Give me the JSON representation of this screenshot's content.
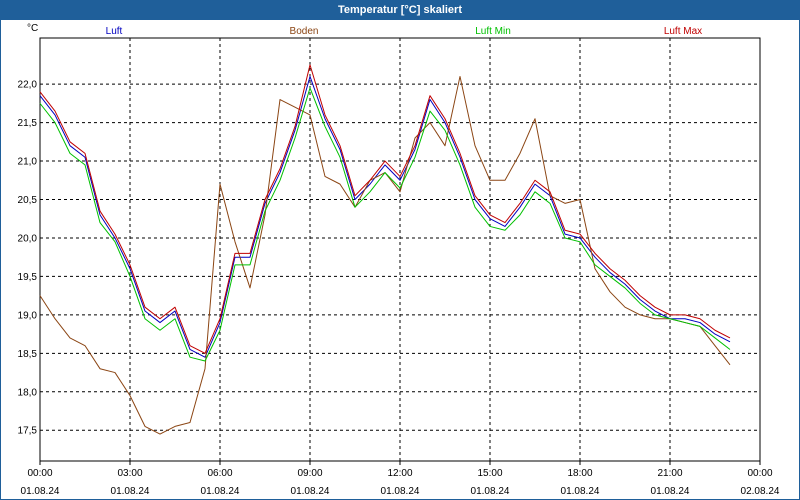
{
  "window": {
    "title": "Temperatur [°C] skaliert"
  },
  "chart_data": {
    "type": "line",
    "title": "Temperatur [°C] skaliert",
    "ylabel": "°C",
    "xlabel": "",
    "grid": true,
    "legend_position": "top",
    "ylim": [
      17.1,
      22.6
    ],
    "xlim": [
      0,
      24
    ],
    "yticks": [
      "17,5",
      "18,0",
      "18,5",
      "19,0",
      "19,5",
      "20,0",
      "20,5",
      "21,0",
      "21,5",
      "22,0"
    ],
    "xticks": [
      {
        "time": "00:00",
        "date": "01.08.24"
      },
      {
        "time": "03:00",
        "date": "01.08.24"
      },
      {
        "time": "06:00",
        "date": "01.08.24"
      },
      {
        "time": "09:00",
        "date": "01.08.24"
      },
      {
        "time": "12:00",
        "date": "01.08.24"
      },
      {
        "time": "15:00",
        "date": "01.08.24"
      },
      {
        "time": "18:00",
        "date": "01.08.24"
      },
      {
        "time": "21:00",
        "date": "01.08.24"
      },
      {
        "time": "00:00",
        "date": "02.08.24"
      }
    ],
    "x_hours": [
      0,
      0.5,
      1,
      1.5,
      2,
      2.5,
      3,
      3.5,
      4,
      4.5,
      5,
      5.5,
      6,
      6.5,
      7,
      7.5,
      8,
      8.5,
      9,
      9.5,
      10,
      10.5,
      11,
      11.5,
      12,
      12.5,
      13,
      13.5,
      14,
      14.5,
      15,
      15.5,
      16,
      16.5,
      17,
      17.5,
      18,
      18.5,
      19,
      19.5,
      20,
      20.5,
      21,
      21.5,
      22,
      22.5,
      23,
      23.5,
      24
    ],
    "series": [
      {
        "name": "Luft",
        "color": "#0000c0",
        "values": [
          21.85,
          21.6,
          21.2,
          21.05,
          20.3,
          20.0,
          19.6,
          19.05,
          18.9,
          19.05,
          18.55,
          18.45,
          18.9,
          19.75,
          19.75,
          20.45,
          20.85,
          21.4,
          22.1,
          21.55,
          21.15,
          20.5,
          20.7,
          20.95,
          20.75,
          21.15,
          21.8,
          21.5,
          21.05,
          20.5,
          20.25,
          20.15,
          20.4,
          20.7,
          20.55,
          20.05,
          20.0,
          19.75,
          19.55,
          19.4,
          19.2,
          19.05,
          18.95,
          18.95,
          18.9,
          18.75,
          18.65
        ]
      },
      {
        "name": "Boden",
        "color": "#8b4513",
        "values": [
          19.25,
          18.95,
          18.7,
          18.6,
          18.3,
          18.25,
          17.95,
          17.55,
          17.45,
          17.55,
          17.6,
          18.3,
          20.7,
          19.95,
          19.35,
          20.3,
          21.8,
          21.7,
          21.6,
          20.8,
          20.7,
          20.4,
          20.75,
          20.85,
          20.6,
          21.3,
          21.5,
          21.2,
          22.1,
          21.2,
          20.75,
          20.75,
          21.1,
          21.55,
          20.55,
          20.45,
          20.5,
          19.6,
          19.3,
          19.1,
          19.0,
          18.95,
          18.95,
          18.9,
          18.85,
          18.6,
          18.35
        ]
      },
      {
        "name": "Luft Min",
        "color": "#00c000",
        "values": [
          21.75,
          21.5,
          21.1,
          20.95,
          20.2,
          19.95,
          19.5,
          18.95,
          18.8,
          18.95,
          18.45,
          18.4,
          18.8,
          19.65,
          19.65,
          20.35,
          20.75,
          21.3,
          21.95,
          21.45,
          21.05,
          20.4,
          20.6,
          20.85,
          20.65,
          21.05,
          21.65,
          21.4,
          20.95,
          20.4,
          20.15,
          20.1,
          20.3,
          20.6,
          20.45,
          20.0,
          19.95,
          19.65,
          19.5,
          19.35,
          19.15,
          19.0,
          18.95,
          18.9,
          18.85,
          18.7,
          18.55
        ]
      },
      {
        "name": "Luft Max",
        "color": "#c00000",
        "values": [
          21.9,
          21.65,
          21.25,
          21.1,
          20.35,
          20.05,
          19.65,
          19.1,
          18.95,
          19.1,
          18.6,
          18.5,
          18.95,
          19.8,
          19.8,
          20.5,
          20.9,
          21.45,
          22.25,
          21.6,
          21.2,
          20.55,
          20.75,
          21.0,
          20.8,
          21.2,
          21.85,
          21.55,
          21.1,
          20.55,
          20.3,
          20.2,
          20.45,
          20.75,
          20.6,
          20.1,
          20.05,
          19.8,
          19.6,
          19.45,
          19.25,
          19.1,
          19.0,
          19.0,
          18.95,
          18.8,
          18.7
        ]
      }
    ]
  }
}
